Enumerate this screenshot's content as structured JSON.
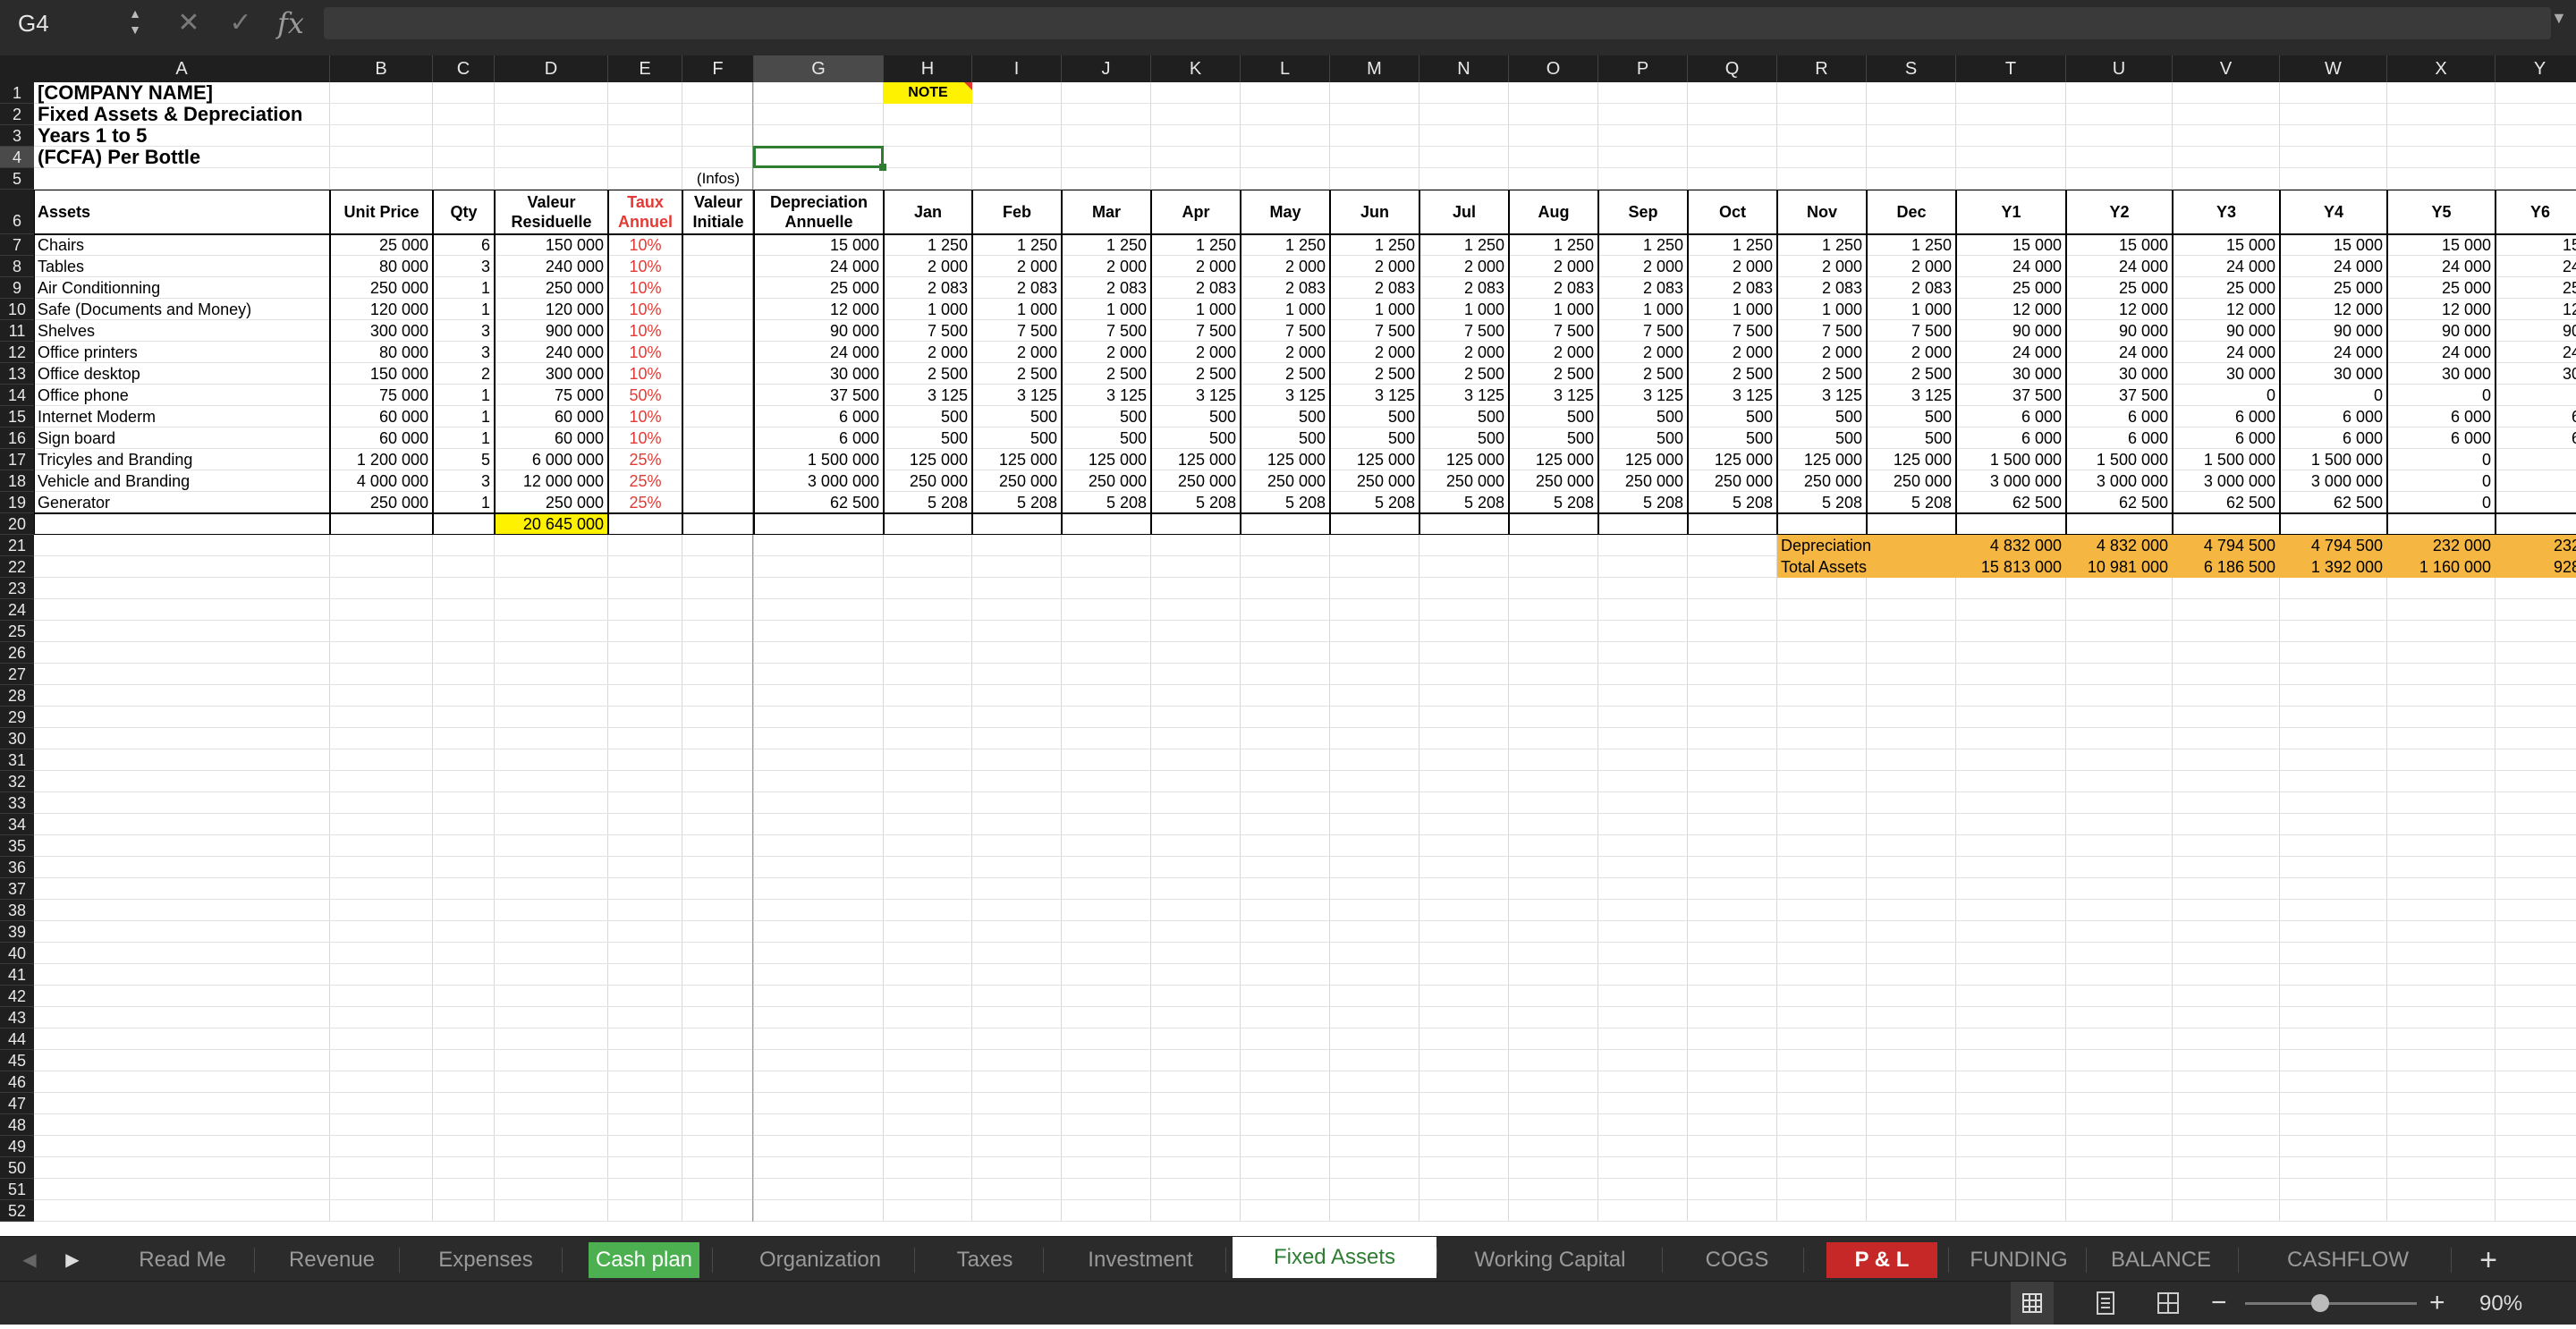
{
  "formula_bar": {
    "name_box": "G4",
    "fx_label": "fx",
    "formula": ""
  },
  "columns": [
    "A",
    "B",
    "C",
    "D",
    "E",
    "F",
    "G",
    "H",
    "I",
    "J",
    "K",
    "L",
    "M",
    "N",
    "O",
    "P",
    "Q",
    "R",
    "S",
    "T",
    "U",
    "V",
    "W",
    "X",
    "Y"
  ],
  "rows": [
    "1",
    "2",
    "3",
    "4",
    "5",
    "6",
    "7",
    "8",
    "9",
    "10",
    "11",
    "12",
    "13",
    "14",
    "15",
    "16",
    "17",
    "18",
    "19",
    "20",
    "21",
    "22",
    "23",
    "24",
    "25",
    "26",
    "27",
    "28",
    "29",
    "30",
    "31",
    "32",
    "33",
    "34",
    "35",
    "36",
    "37",
    "38",
    "39",
    "40",
    "41",
    "42",
    "43",
    "44",
    "45",
    "46",
    "47",
    "48",
    "49",
    "50",
    "51",
    "52"
  ],
  "header_block": {
    "company": "[COMPANY NAME]",
    "subtitle": "Fixed Assets & Depreciation",
    "years": "Years 1 to 5",
    "unit": "(FCFA) Per Bottle",
    "note": "NOTE",
    "infos": "(Infos)"
  },
  "table_headers": [
    "Assets",
    "Unit Price",
    "Qty",
    "Valeur Residuelle",
    "Taux Annuel",
    "Valeur Initiale",
    "Depreciation Annuelle",
    "Jan",
    "Feb",
    "Mar",
    "Apr",
    "May",
    "Jun",
    "Jul",
    "Aug",
    "Sep",
    "Oct",
    "Nov",
    "Dec",
    "Y1",
    "Y2",
    "Y3",
    "Y4",
    "Y5",
    "Y6"
  ],
  "assets": [
    {
      "name": "Chairs",
      "price": "25 000",
      "qty": "6",
      "resid": "150 000",
      "rate": "10%",
      "dep": "15 000",
      "month": "1 250",
      "y": [
        "15 000",
        "15 000",
        "15 000",
        "15 000",
        "15 000",
        "15"
      ]
    },
    {
      "name": "Tables",
      "price": "80 000",
      "qty": "3",
      "resid": "240 000",
      "rate": "10%",
      "dep": "24 000",
      "month": "2 000",
      "y": [
        "24 000",
        "24 000",
        "24 000",
        "24 000",
        "24 000",
        "24"
      ]
    },
    {
      "name": "Air Conditionning",
      "price": "250 000",
      "qty": "1",
      "resid": "250 000",
      "rate": "10%",
      "dep": "25 000",
      "month": "2 083",
      "y": [
        "25 000",
        "25 000",
        "25 000",
        "25 000",
        "25 000",
        "25"
      ]
    },
    {
      "name": "Safe (Documents and Money)",
      "price": "120 000",
      "qty": "1",
      "resid": "120 000",
      "rate": "10%",
      "dep": "12 000",
      "month": "1 000",
      "y": [
        "12 000",
        "12 000",
        "12 000",
        "12 000",
        "12 000",
        "12"
      ]
    },
    {
      "name": "Shelves",
      "price": "300 000",
      "qty": "3",
      "resid": "900 000",
      "rate": "10%",
      "dep": "90 000",
      "month": "7 500",
      "y": [
        "90 000",
        "90 000",
        "90 000",
        "90 000",
        "90 000",
        "90"
      ]
    },
    {
      "name": "Office printers",
      "price": "80 000",
      "qty": "3",
      "resid": "240 000",
      "rate": "10%",
      "dep": "24 000",
      "month": "2 000",
      "y": [
        "24 000",
        "24 000",
        "24 000",
        "24 000",
        "24 000",
        "24"
      ]
    },
    {
      "name": "Office desktop",
      "price": "150 000",
      "qty": "2",
      "resid": "300 000",
      "rate": "10%",
      "dep": "30 000",
      "month": "2 500",
      "y": [
        "30 000",
        "30 000",
        "30 000",
        "30 000",
        "30 000",
        "30"
      ]
    },
    {
      "name": "Office phone",
      "price": "75 000",
      "qty": "1",
      "resid": "75 000",
      "rate": "50%",
      "dep": "37 500",
      "month": "3 125",
      "y": [
        "37 500",
        "37 500",
        "0",
        "0",
        "0",
        ""
      ]
    },
    {
      "name": "Internet Moderm",
      "price": "60 000",
      "qty": "1",
      "resid": "60 000",
      "rate": "10%",
      "dep": "6 000",
      "month": "500",
      "y": [
        "6 000",
        "6 000",
        "6 000",
        "6 000",
        "6 000",
        "6"
      ]
    },
    {
      "name": "Sign board",
      "price": "60 000",
      "qty": "1",
      "resid": "60 000",
      "rate": "10%",
      "dep": "6 000",
      "month": "500",
      "y": [
        "6 000",
        "6 000",
        "6 000",
        "6 000",
        "6 000",
        "6"
      ]
    },
    {
      "name": "Tricyles and Branding",
      "price": "1 200 000",
      "qty": "5",
      "resid": "6 000 000",
      "rate": "25%",
      "dep": "1 500 000",
      "month": "125 000",
      "y": [
        "1 500 000",
        "1 500 000",
        "1 500 000",
        "1 500 000",
        "0",
        ""
      ]
    },
    {
      "name": "Vehicle and Branding",
      "price": "4 000 000",
      "qty": "3",
      "resid": "12 000 000",
      "rate": "25%",
      "dep": "3 000 000",
      "month": "250 000",
      "y": [
        "3 000 000",
        "3 000 000",
        "3 000 000",
        "3 000 000",
        "0",
        ""
      ]
    },
    {
      "name": "Generator",
      "price": "250 000",
      "qty": "1",
      "resid": "250 000",
      "rate": "25%",
      "dep": "62 500",
      "month": "5 208",
      "y": [
        "62 500",
        "62 500",
        "62 500",
        "62 500",
        "0",
        ""
      ]
    }
  ],
  "total_resid": "20 645 000",
  "summary": {
    "depreciation_label": "Depreciation",
    "depreciation": [
      "4 832 000",
      "4 832 000",
      "4 794 500",
      "4 794 500",
      "232 000",
      "232"
    ],
    "total_assets_label": "Total Assets",
    "total_assets": [
      "15 813 000",
      "10 981 000",
      "6 186 500",
      "1 392 000",
      "1 160 000",
      "928"
    ]
  },
  "sheet_tabs": [
    {
      "label": "Read Me",
      "style": "normal"
    },
    {
      "label": "Revenue",
      "style": "normal"
    },
    {
      "label": "Expenses",
      "style": "normal"
    },
    {
      "label": "Cash plan",
      "style": "green"
    },
    {
      "label": "Organization",
      "style": "normal"
    },
    {
      "label": "Taxes",
      "style": "normal"
    },
    {
      "label": "Investment",
      "style": "normal"
    },
    {
      "label": "Fixed Assets",
      "style": "active"
    },
    {
      "label": "Working Capital",
      "style": "normal"
    },
    {
      "label": "COGS",
      "style": "normal"
    },
    {
      "label": "P & L",
      "style": "red"
    },
    {
      "label": "FUNDING",
      "style": "normal"
    },
    {
      "label": "BALANCE",
      "style": "normal"
    },
    {
      "label": "CASHFLOW",
      "style": "normal"
    }
  ],
  "status": {
    "zoom": "90%"
  },
  "colors": {
    "note": "#fff200",
    "orange": "#f5b642",
    "highlight_yellow": "#fff200",
    "red_text": "#e53935",
    "active_tab_text": "#2e7d32",
    "green_tab": "#4caf50",
    "red_tab": "#c62828"
  }
}
